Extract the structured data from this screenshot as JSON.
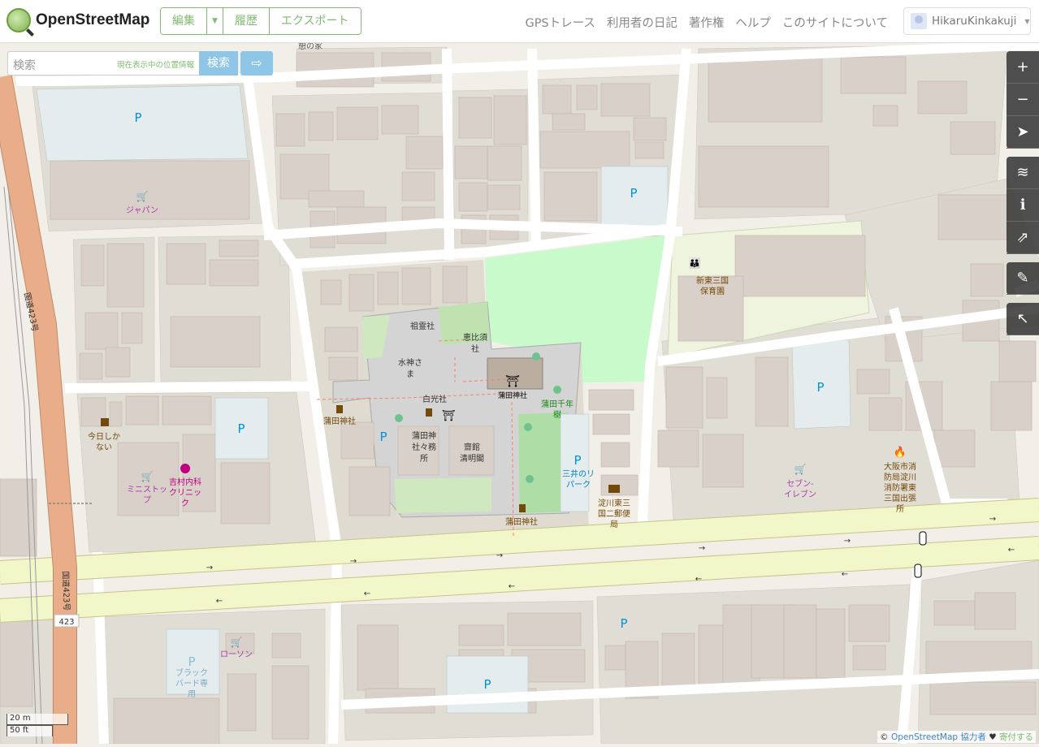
{
  "header": {
    "logo_text": "OpenStreetMap",
    "edit_label": "編集",
    "history_label": "履歴",
    "export_label": "エクスポート",
    "nav": [
      "GPSトレース",
      "利用者の日記",
      "著作権",
      "ヘルプ",
      "このサイトについて"
    ],
    "username": "HikaruKinkakuji"
  },
  "search": {
    "placeholder": "検索",
    "where_label": "現在表示中の位置情報",
    "button": "検索"
  },
  "map": {
    "labels": {
      "shrine_main": "蒲田神社",
      "shrine_sw": "蒲田神社",
      "shrine_s": "蒲田神社",
      "sosha": "祖霊社",
      "ebisu1": "恵比須",
      "ebisu2": "社",
      "mizugami1": "水神さ",
      "mizugami2": "ま",
      "hakko": "白光社",
      "office1": "蒲田神",
      "office2": "社々務",
      "office3": "所",
      "saikan1": "齋館",
      "saikan2": "清明閣",
      "tree1": "蒲田千年",
      "tree2": "樹",
      "mitsui1": "三井のリ",
      "mitsui2": "パーク",
      "post1": "淀川東三",
      "post2": "国二郵便",
      "post3": "局",
      "nursery1": "新東三国",
      "nursery2": "保育園",
      "japan": "ジャパン",
      "kyoushika1": "今日しか",
      "kyoushika2": "ない",
      "ministop1": "ミニストッ",
      "ministop2": "プ",
      "clinic1": "吉村内科",
      "clinic2": "クリニッ",
      "clinic3": "ク",
      "seven1": "セブン-",
      "seven2": "イレブン",
      "fire1": "大阪市消",
      "fire2": "防局淀川",
      "fire3": "消防署東",
      "fire4": "三国出張",
      "fire5": "所",
      "lawson": "ローソン",
      "black1": "ブラック",
      "black2": "バード専",
      "black3": "用",
      "route1": "国道423号",
      "route2": "国道423号",
      "route_shield": "423",
      "top_label": "憩の家"
    },
    "parking_symbol": "P"
  },
  "scale": {
    "metric": "20 m",
    "imperial": "50 ft"
  },
  "attribution": {
    "prefix": "©",
    "osm": "OpenStreetMap",
    "contributors": "協力者",
    "heart": "♥",
    "donate": "寄付する"
  },
  "controls": [
    "zoom-in",
    "zoom-out",
    "locate",
    "layers",
    "info",
    "share",
    "note",
    "query"
  ],
  "colors": {
    "road_major": "#f7fabf",
    "road_trunk": "#e9ad8a",
    "park": "#c8facc",
    "building": "#d9d0c9",
    "brand": "#7ebc6f"
  }
}
